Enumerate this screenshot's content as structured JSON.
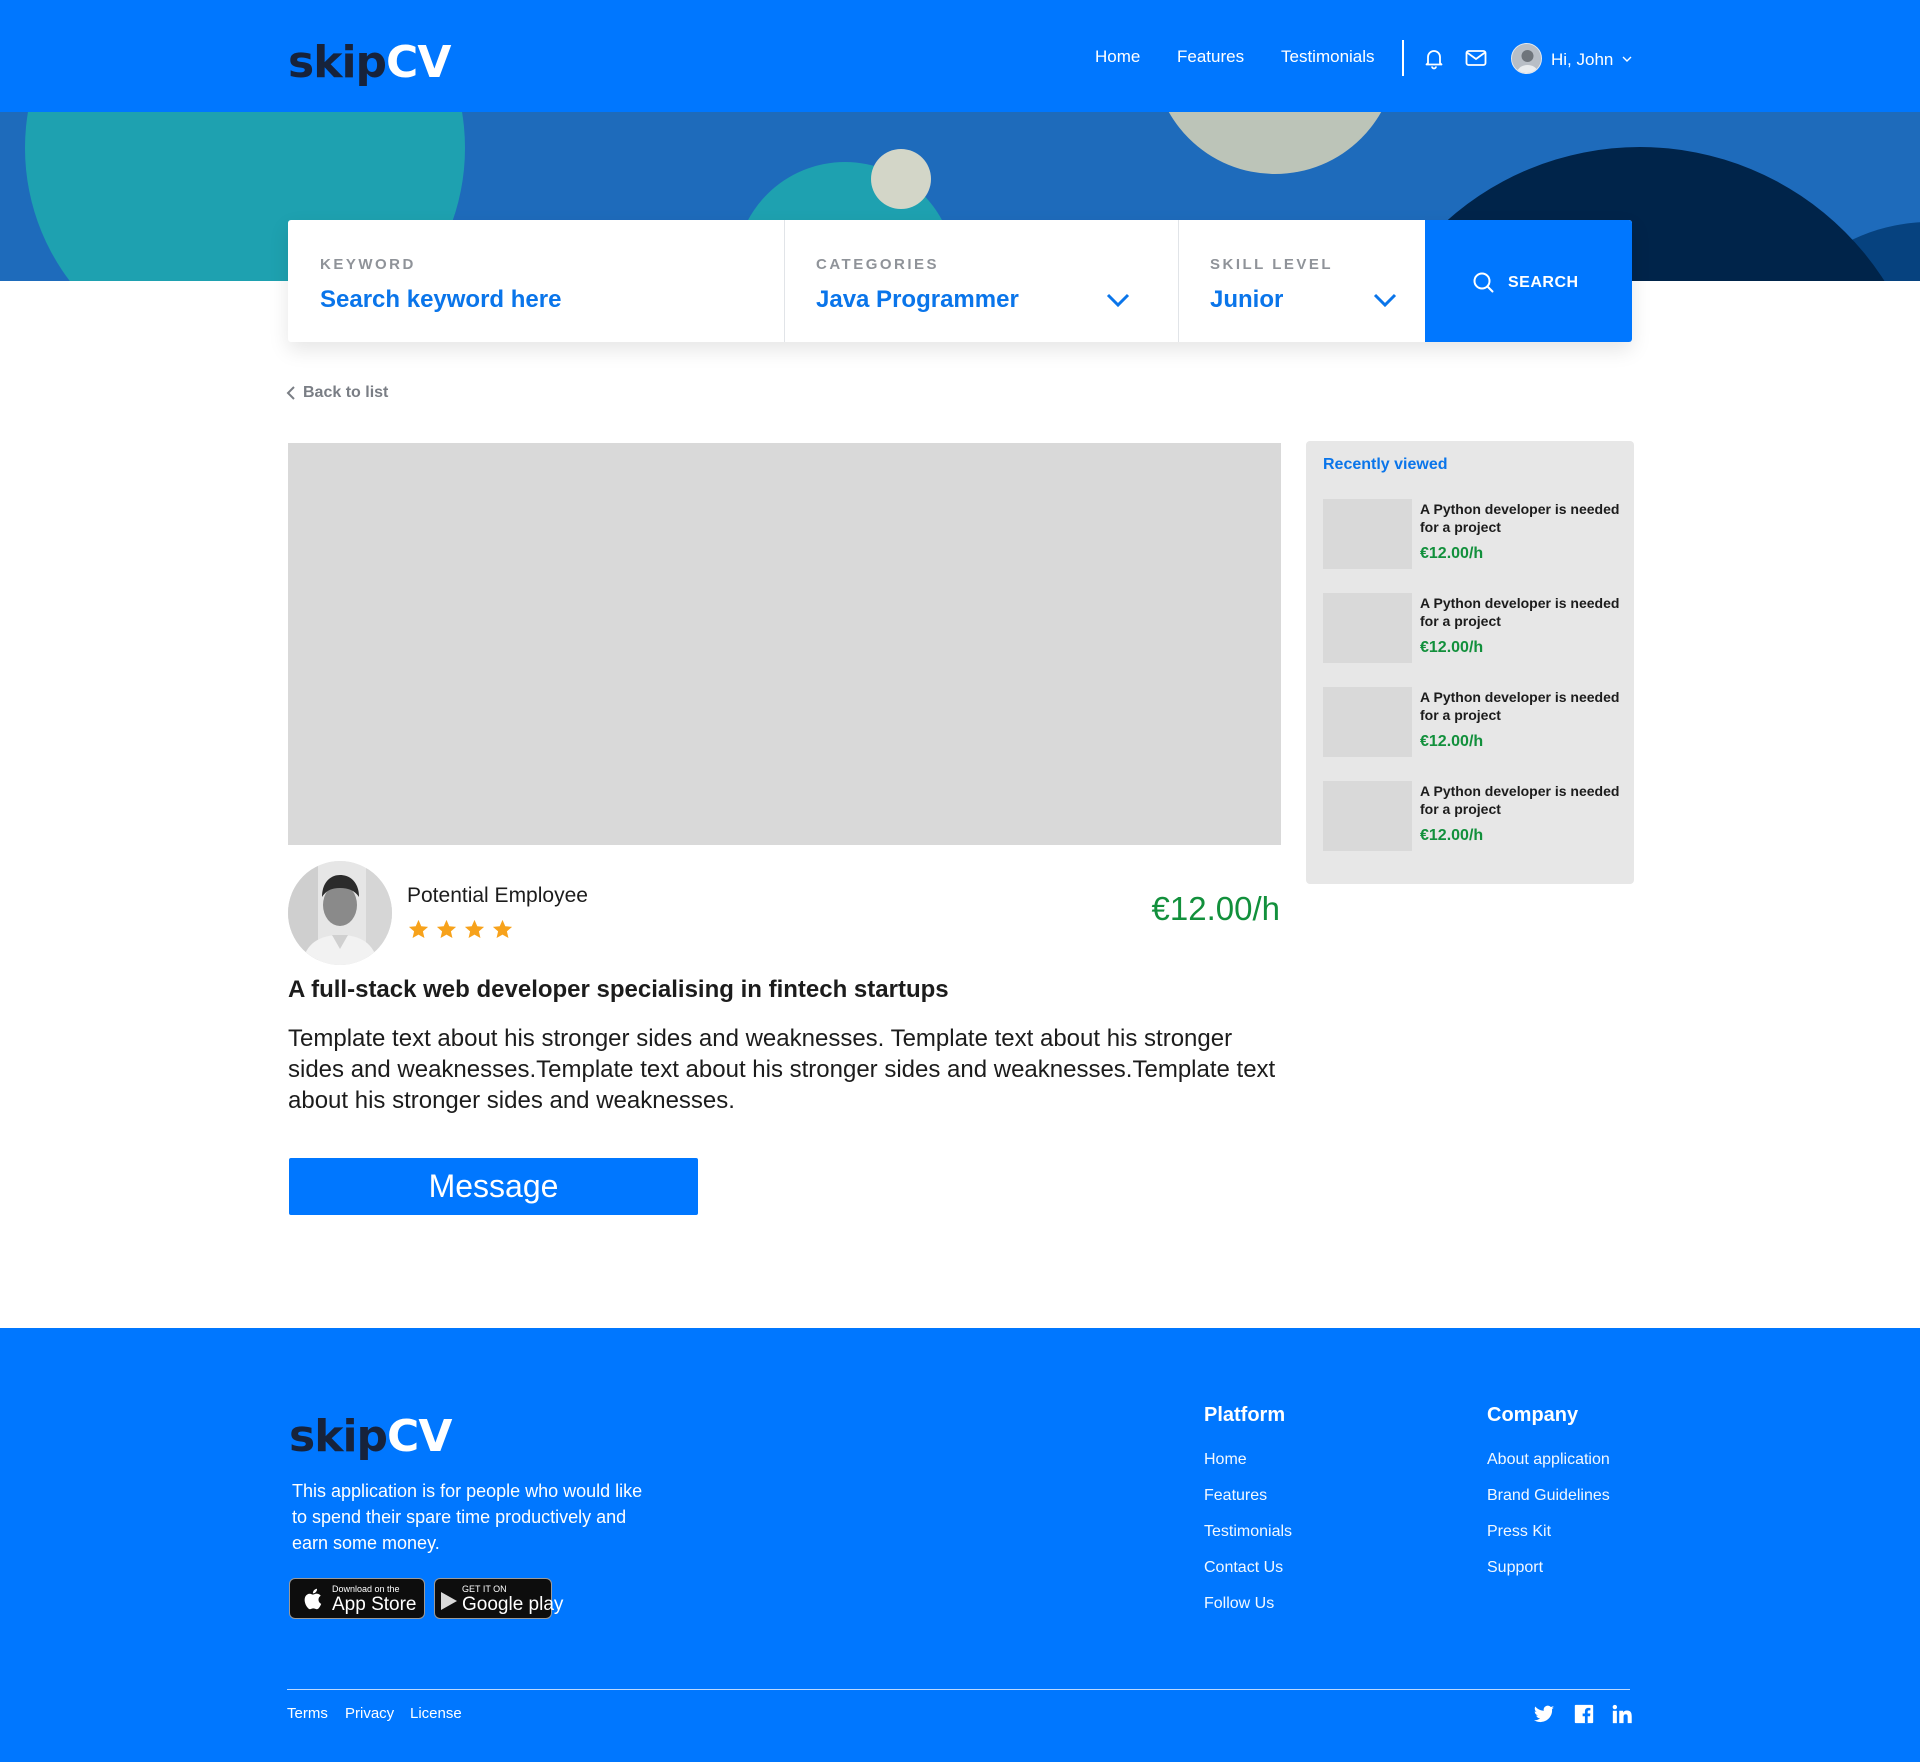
{
  "header": {
    "logo_part1": "skip",
    "logo_part2": "CV",
    "nav": [
      "Home",
      "Features",
      "Testimonials"
    ],
    "user_greeting": "Hi, John"
  },
  "search": {
    "keyword_label": "KEYWORD",
    "keyword_value": "Search keyword here",
    "categories_label": "CATEGORIES",
    "categories_value": "Java Programmer",
    "skill_label": "SKILL LEVEL",
    "skill_value": "Junior",
    "button_label": "SEARCH"
  },
  "back_link": "Back to list",
  "profile": {
    "name": "Potential Employee",
    "rating": 4,
    "price": "€12.00/h",
    "title": "A full-stack web developer specialising in fintech startups",
    "description": "Template text about his stronger sides and weaknesses. Template text about his stronger sides and weaknesses.Template text about his stronger sides and weaknesses.Template text about his stronger sides and weaknesses.",
    "message_button": "Message"
  },
  "recently_viewed": {
    "title": "Recently viewed",
    "items": [
      {
        "text": "A Python developer is needed for a project",
        "price": "€12.00/h"
      },
      {
        "text": "A Python developer is needed for a project",
        "price": "€12.00/h"
      },
      {
        "text": "A Python developer is needed for a project",
        "price": "€12.00/h"
      },
      {
        "text": "A Python developer is needed for a project",
        "price": "€12.00/h"
      }
    ]
  },
  "footer": {
    "logo_part1": "skip",
    "logo_part2": "CV",
    "about": "This application is for people who would like to spend their spare time productively and earn some money.",
    "app_store_small": "Download on the",
    "app_store_big": "App Store",
    "google_play_small": "GET IT ON",
    "google_play_big": "Google play",
    "platform_title": "Platform",
    "platform_links": [
      "Home",
      "Features",
      "Testimonials",
      "Contact Us",
      "Follow Us"
    ],
    "company_title": "Company",
    "company_links": [
      "About application",
      "Brand Guidelines",
      "Press Kit",
      "Support"
    ],
    "legal_links": [
      "Terms",
      "Privacy",
      "License"
    ]
  },
  "colors": {
    "primary": "#0077ff",
    "price_green": "#12903c",
    "star": "#f7a21b",
    "hero": "#1e6bbb"
  }
}
